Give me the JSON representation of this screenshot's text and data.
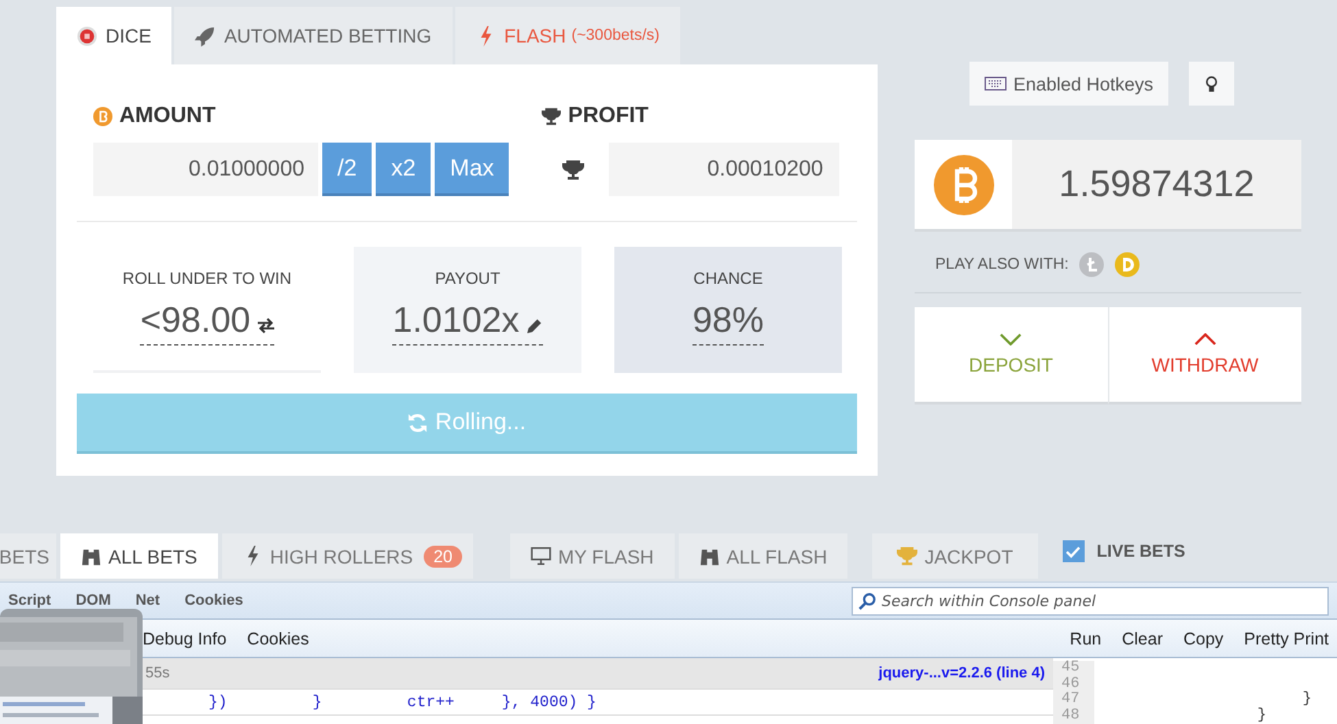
{
  "game_tabs": [
    {
      "label": "DICE",
      "kind": "dice",
      "selected": true
    },
    {
      "label": "AUTOMATED BETTING",
      "kind": "auto",
      "selected": false
    },
    {
      "label": "FLASH",
      "note": "(~300bets/s)",
      "kind": "flash",
      "selected": false
    }
  ],
  "amount": {
    "label": "AMOUNT",
    "value": "0.01000000",
    "buttons": [
      "/2",
      "x2",
      "Max"
    ]
  },
  "profit": {
    "label": "PROFIT",
    "value": "0.00010200"
  },
  "stats": [
    {
      "label": "ROLL UNDER TO WIN",
      "value": "<98.00",
      "kind": "reversible"
    },
    {
      "label": "PAYOUT",
      "value": "1.0102x",
      "kind": "editable"
    },
    {
      "label": "CHANCE",
      "value": "98%",
      "kind": "plain"
    }
  ],
  "roll_button": {
    "label": "Rolling..."
  },
  "hotkeys_button": {
    "label": "Enabled Hotkeys"
  },
  "balance": "1.59874312",
  "play_also": {
    "label": "PLAY ALSO WITH:",
    "coins": [
      {
        "kind": "litecoin"
      },
      {
        "kind": "dogecoin"
      }
    ]
  },
  "actions": [
    {
      "label": "DEPOSIT",
      "kind": "deposit"
    },
    {
      "label": "WITHDRAW",
      "kind": "withdraw"
    }
  ],
  "bet_tabs": [
    {
      "label": "BETS",
      "kind": "plain",
      "selected": false
    },
    {
      "label": "ALL BETS",
      "kind": "all",
      "selected": true
    },
    {
      "label": "HIGH ROLLERS",
      "kind": "flash",
      "badge": "20",
      "selected": false
    },
    {
      "label": "MY FLASH",
      "kind": "mine",
      "selected": false
    },
    {
      "label": "ALL FLASH",
      "kind": "all",
      "selected": false
    },
    {
      "label": "JACKPOT",
      "kind": "jackpot",
      "selected": false
    }
  ],
  "live_bets": {
    "label": "LIVE BETS",
    "checked": true
  },
  "devtools": {
    "panel_tabs": [
      "Script",
      "DOM",
      "Net",
      "Cookies"
    ],
    "search": {
      "placeholder": "Search within Console panel"
    },
    "console_tabs": [
      "Debug Info",
      "Cookies"
    ],
    "actions": [
      "Run",
      "Clear",
      "Copy",
      "Pretty Print"
    ],
    "log": {
      "time": "55s",
      "source": "jquery-...v=2.2.6 (line 4)",
      "code": "})         }         ctr++     }, 4000) }"
    },
    "editor": [
      {
        "number": "45"
      },
      {
        "number": "46"
      },
      {
        "number": "47",
        "code": "                       }"
      },
      {
        "number": "48",
        "code": "                  }"
      }
    ]
  }
}
